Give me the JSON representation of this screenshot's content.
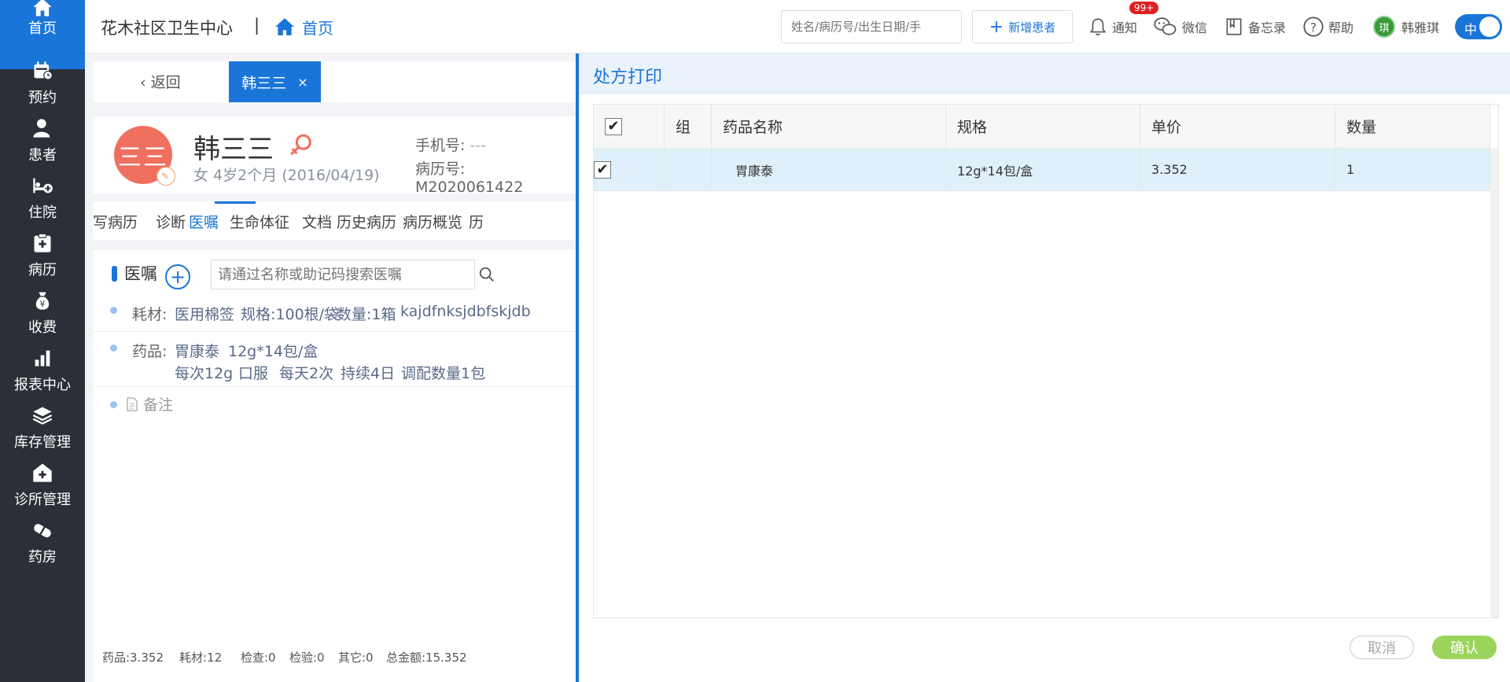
{
  "sidebar": {
    "items": [
      {
        "label": "首页",
        "icon": "home-icon"
      },
      {
        "label": "预约",
        "icon": "calendar-icon"
      },
      {
        "label": "患者",
        "icon": "patient-icon"
      },
      {
        "label": "住院",
        "icon": "bed-icon"
      },
      {
        "label": "病历",
        "icon": "medical-record-icon"
      },
      {
        "label": "收费",
        "icon": "money-bag-icon"
      },
      {
        "label": "报表中心",
        "icon": "bar-chart-icon"
      },
      {
        "label": "库存管理",
        "icon": "layers-icon"
      },
      {
        "label": "诊所管理",
        "icon": "clinic-icon"
      },
      {
        "label": "药房",
        "icon": "pill-icon"
      }
    ]
  },
  "header": {
    "clinic_name": "花木社区卫生中心",
    "separator": "|",
    "home_link": "首页",
    "search_placeholder": "姓名/病历号/出生日期/手",
    "add_patient": "新增患者",
    "notify": "通知",
    "notify_badge": "99+",
    "wechat": "微信",
    "memo": "备忘录",
    "help": "帮助",
    "user_avatar": "琪",
    "user_name": "韩雅琪",
    "lang_toggle": "中"
  },
  "patient_tabs": {
    "back": "返回",
    "active_tab": "韩三三",
    "close": "×"
  },
  "patient": {
    "avatar_text": "三三",
    "avatar_edit": "✎",
    "name": "韩三三",
    "info": "女  4岁2个月  (2016/04/19)",
    "phone_label": "手机号:",
    "phone_value": "---",
    "mrn": "病历号: M2020061422"
  },
  "record_menu": {
    "items": [
      "写病历",
      "诊断",
      "医嘱",
      "生命体征",
      "文档",
      "历史病历",
      "病历概览",
      "历"
    ],
    "active_index": 2
  },
  "orders": {
    "title": "医嘱",
    "add": "+",
    "search_placeholder": "请通过名称或助记码搜索医嘱",
    "material": {
      "label": "耗材:",
      "name": "医用棉签",
      "spec": "规格:100根/袋",
      "qty": "数量:1箱",
      "extra": "kajdfnksjdbfskjdb"
    },
    "drug": {
      "label": "药品:",
      "name": "胃康泰",
      "spec": "12g*14包/盒",
      "dose": "每次12g",
      "route": "口服",
      "freq": "每天2次",
      "duration": "持续4日",
      "dispense": "调配数量1包"
    },
    "remark": "备注"
  },
  "footer": {
    "drug": "药品:3.352",
    "material": "耗材:12",
    "exam": "检查:0",
    "test": "检验:0",
    "other": "其它:0",
    "total": "总金额:15.352"
  },
  "dialog": {
    "title": "处方打印",
    "columns": [
      "组",
      "药品名称",
      "规格",
      "单价",
      "数量"
    ],
    "rows": [
      {
        "checked": true,
        "group": "",
        "name": "胃康泰",
        "spec": "12g*14包/盒",
        "price": "3.352",
        "qty": "1"
      }
    ],
    "cancel": "取消",
    "confirm": "确认"
  },
  "colors": {
    "accent": "#1a75d9",
    "nav_bg": "#2b3038",
    "confirm_green": "#9bd45a",
    "avatar_red": "#f07060"
  }
}
